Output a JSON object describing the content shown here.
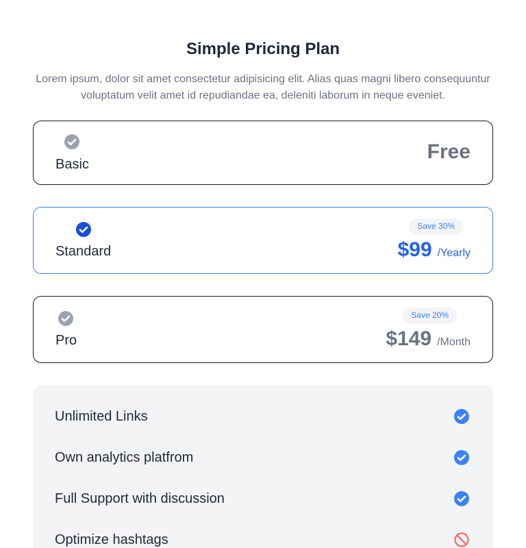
{
  "header": {
    "title": "Simple Pricing Plan",
    "subtitle": "Lorem ipsum, dolor sit amet consectetur adipisicing elit. Alias quas magni libero consequuntur voluptatum velit amet id repudiandae ea, deleniti laborum in neque eveniet."
  },
  "plans": [
    {
      "name": "Basic",
      "price": "Free",
      "period": "",
      "badge": "",
      "selected": false
    },
    {
      "name": "Standard",
      "price": "$99",
      "period": "/Yearly",
      "badge": "Save 30%",
      "selected": true
    },
    {
      "name": "Pro",
      "price": "$149",
      "period": "/Month",
      "badge": "Save 20%",
      "selected": false
    }
  ],
  "features": [
    {
      "label": "Unlimited Links",
      "included": true,
      "icon": "check-circle-icon"
    },
    {
      "label": "Own analytics platfrom",
      "included": true,
      "icon": "check-circle-icon"
    },
    {
      "label": "Full Support with discussion",
      "included": true,
      "icon": "check-circle-icon"
    },
    {
      "label": "Optimize hashtags",
      "included": false,
      "icon": "block-icon"
    }
  ],
  "colors": {
    "accent": "#2563eb",
    "check_blue": "#3b82f6",
    "check_gray": "#9ca3af",
    "block_red": "#f87171",
    "panel_bg": "#f3f4f6"
  }
}
